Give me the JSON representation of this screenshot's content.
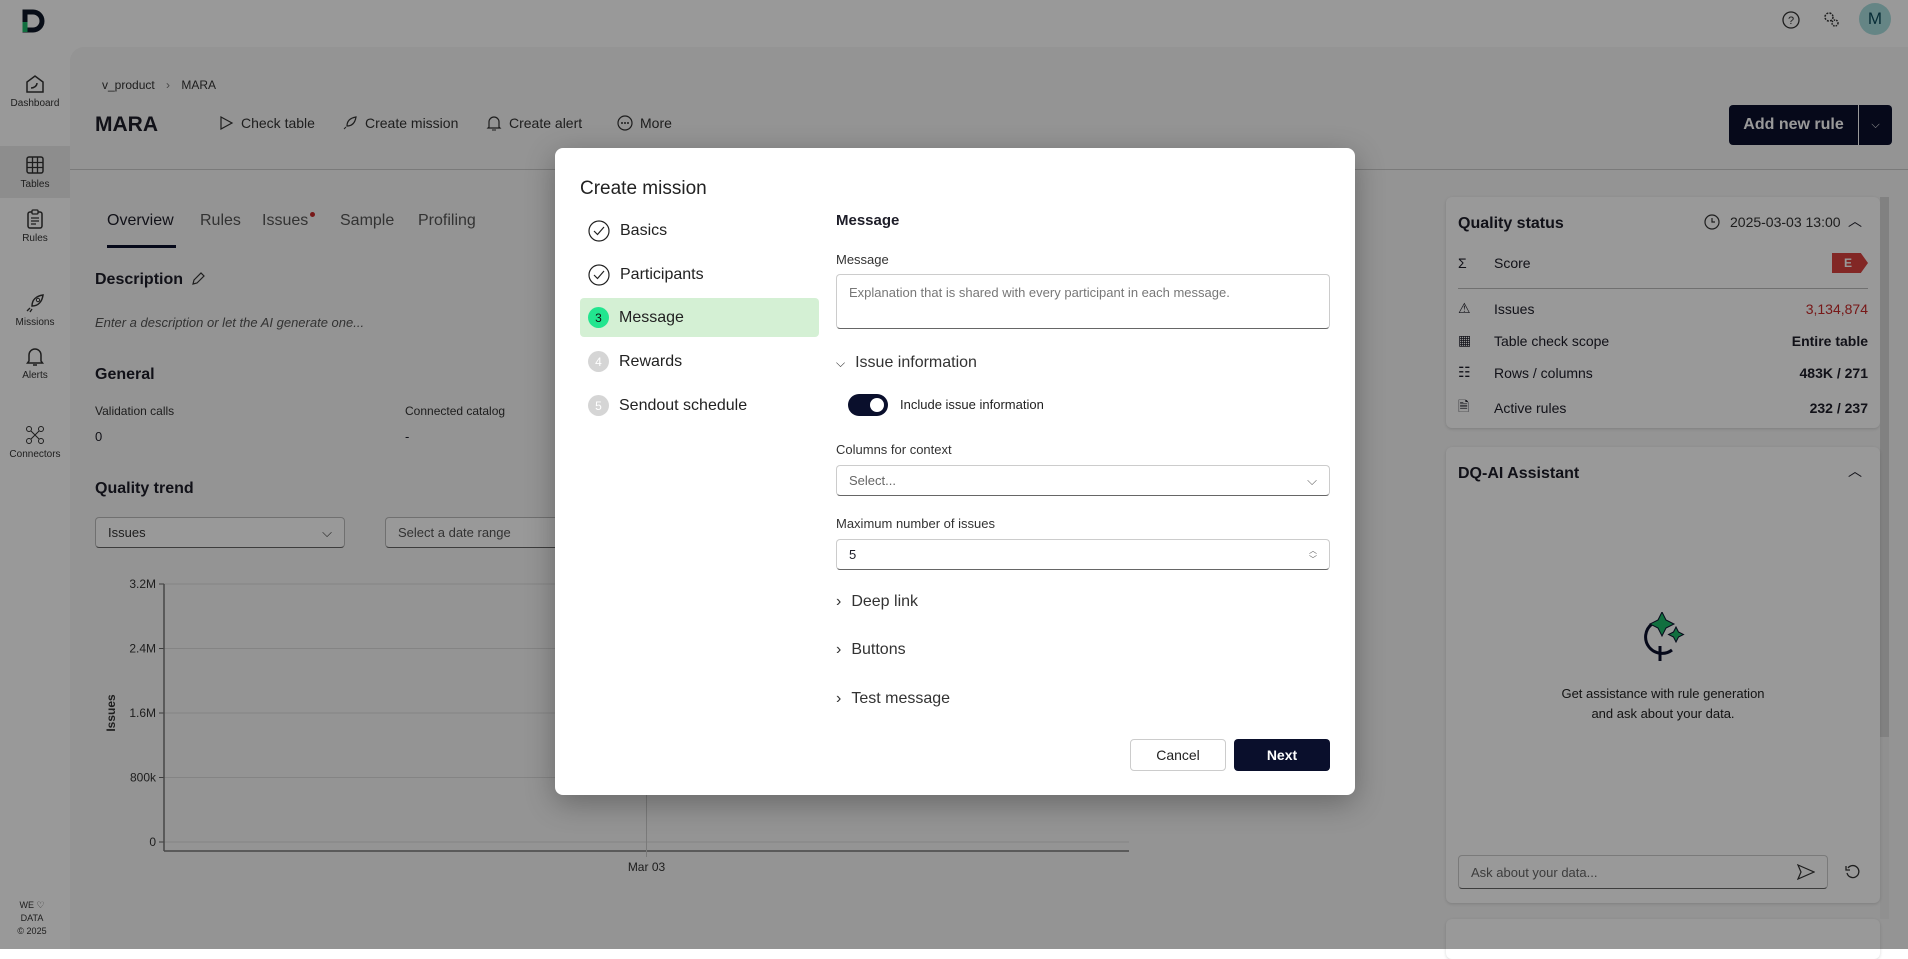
{
  "topbar": {
    "avatar_initial": "M"
  },
  "sidebar": {
    "items": [
      {
        "label": "Dashboard"
      },
      {
        "label": "Tables"
      },
      {
        "label": "Rules"
      },
      {
        "label": "Missions"
      },
      {
        "label": "Alerts"
      },
      {
        "label": "Connectors"
      }
    ],
    "footer_line1": "WE ♡",
    "footer_line2": "DATA",
    "footer_line3": "© 2025"
  },
  "breadcrumb": {
    "parent": "v_product",
    "separator": "›",
    "current": "MARA"
  },
  "header": {
    "title": "MARA",
    "actions": [
      "Check table",
      "Create mission",
      "Create alert",
      "More"
    ],
    "add_rule": "Add new rule"
  },
  "tabs": [
    "Overview",
    "Rules",
    "Issues",
    "Sample",
    "Profiling"
  ],
  "overview": {
    "description_title": "Description",
    "description_placeholder": "Enter a description or let the AI generate one...",
    "general_title": "General",
    "validation_calls_label": "Validation calls",
    "validation_calls_value": "0",
    "connected_catalog_label": "Connected catalog",
    "connected_catalog_value": "-",
    "quality_trend_title": "Quality trend",
    "metric_select": "Issues",
    "date_range_placeholder": "Select a date range"
  },
  "chart_data": {
    "type": "line",
    "title": "",
    "xlabel": "",
    "ylabel": "Issues",
    "categories": [
      "Mar 03"
    ],
    "series": [],
    "ylim": [
      0,
      3200000
    ],
    "yticks": [
      0,
      800000,
      1600000,
      2400000,
      3200000
    ],
    "ytick_labels": [
      "0",
      "800k",
      "1.6M",
      "2.4M",
      "3.2M"
    ],
    "grid": true
  },
  "quality_status": {
    "title": "Quality status",
    "timestamp": "2025-03-03 13:00",
    "score_label": "Score",
    "score_grade": "E",
    "rows": [
      {
        "label": "Issues",
        "value": "3,134,874"
      },
      {
        "label": "Table check scope",
        "value": "Entire table"
      },
      {
        "label": "Rows / columns",
        "value": "483K / 271"
      },
      {
        "label": "Active rules",
        "value": "232 / 237"
      }
    ],
    "colors": {
      "issues": "#c62828",
      "grade": "#d9423f"
    }
  },
  "assistant": {
    "title": "DQ-AI Assistant",
    "description_line1": "Get assistance with rule generation",
    "description_line2": "and ask about your data.",
    "input_placeholder": "Ask about your data..."
  },
  "modal": {
    "title": "Create mission",
    "steps": [
      {
        "label": "Basics",
        "state": "done"
      },
      {
        "label": "Participants",
        "state": "done"
      },
      {
        "label": "Message",
        "state": "active",
        "number": "3"
      },
      {
        "label": "Rewards",
        "state": "pending",
        "number": "4"
      },
      {
        "label": "Sendout schedule",
        "state": "pending",
        "number": "5"
      }
    ],
    "section_title": "Message",
    "message_label": "Message",
    "message_placeholder": "Explanation that is shared with every participant in each message.",
    "issue_info_title": "Issue information",
    "include_issue_label": "Include issue information",
    "include_issue_on": true,
    "columns_label": "Columns for context",
    "columns_placeholder": "Select...",
    "max_issues_label": "Maximum number of issues",
    "max_issues_value": "5",
    "deep_link": "Deep link",
    "buttons": "Buttons",
    "test_message": "Test message",
    "cancel": "Cancel",
    "next": "Next"
  }
}
